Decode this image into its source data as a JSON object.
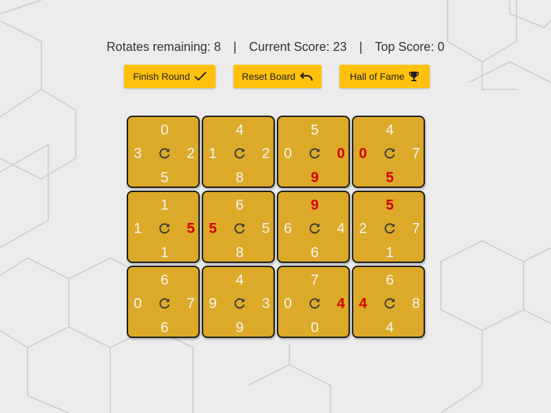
{
  "stats": {
    "rotates_label": "Rotates remaining: 8",
    "score_label": "Current Score: 23",
    "top_label": "Top Score: 0",
    "separator": "|"
  },
  "buttons": {
    "finish": "Finish Round",
    "reset": "Reset Board",
    "hall_of_fame": "Hall of Fame"
  },
  "colors": {
    "tile": "#dcaa28",
    "button": "#ffc10c",
    "highlight": "#d40000"
  },
  "board": {
    "tiles": [
      {
        "top": "0",
        "left": "3",
        "right": "2",
        "bottom": "5",
        "hi": []
      },
      {
        "top": "4",
        "left": "1",
        "right": "2",
        "bottom": "8",
        "hi": []
      },
      {
        "top": "5",
        "left": "0",
        "right": "0",
        "bottom": "9",
        "hi": [
          "right",
          "bottom"
        ]
      },
      {
        "top": "4",
        "left": "0",
        "right": "7",
        "bottom": "5",
        "hi": [
          "left",
          "bottom"
        ]
      },
      {
        "top": "1",
        "left": "1",
        "right": "5",
        "bottom": "1",
        "hi": [
          "right"
        ]
      },
      {
        "top": "6",
        "left": "5",
        "right": "5",
        "bottom": "8",
        "hi": [
          "left"
        ]
      },
      {
        "top": "9",
        "left": "6",
        "right": "4",
        "bottom": "6",
        "hi": [
          "top"
        ]
      },
      {
        "top": "5",
        "left": "2",
        "right": "7",
        "bottom": "1",
        "hi": [
          "top"
        ]
      },
      {
        "top": "6",
        "left": "0",
        "right": "7",
        "bottom": "6",
        "hi": []
      },
      {
        "top": "4",
        "left": "9",
        "right": "3",
        "bottom": "9",
        "hi": []
      },
      {
        "top": "7",
        "left": "0",
        "right": "4",
        "bottom": "0",
        "hi": [
          "right"
        ]
      },
      {
        "top": "6",
        "left": "4",
        "right": "8",
        "bottom": "4",
        "hi": [
          "left"
        ]
      }
    ]
  }
}
